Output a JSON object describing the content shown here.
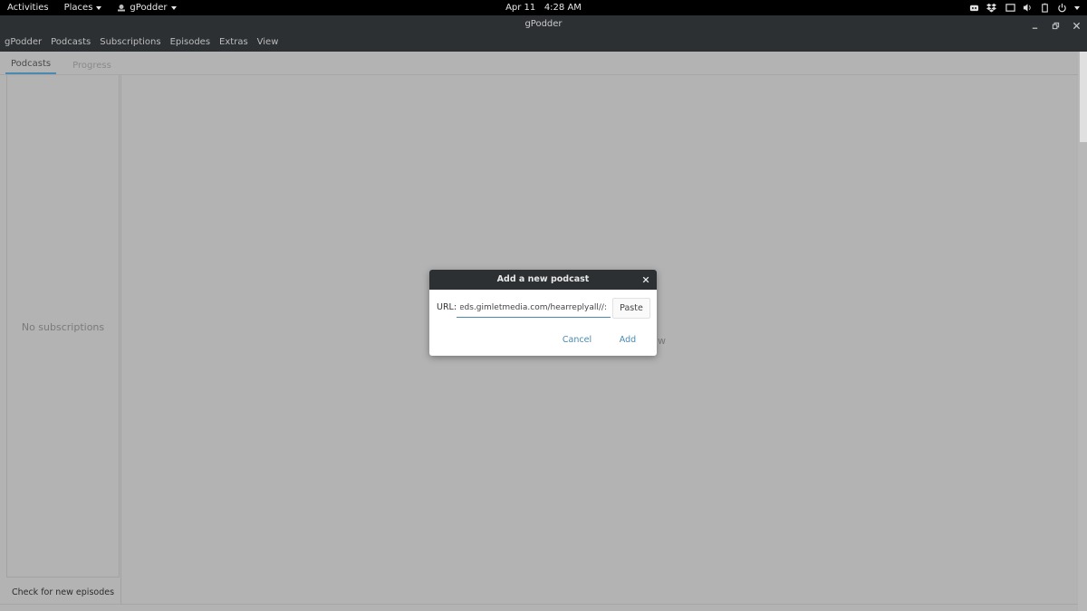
{
  "topbar": {
    "activities": "Activities",
    "places": "Places",
    "app_menu": "gPodder",
    "clock": "Apr 11   4:28 AM",
    "tray_icons": [
      "discord-icon",
      "dropbox-icon",
      "display-icon",
      "volume-icon",
      "battery-icon",
      "power-icon"
    ]
  },
  "window": {
    "title": "gPodder",
    "menu": [
      "gPodder",
      "Podcasts",
      "Subscriptions",
      "Episodes",
      "Extras",
      "View"
    ]
  },
  "tabs": [
    {
      "label": "Podcasts",
      "active": true
    },
    {
      "label": "Progress",
      "active": false
    }
  ],
  "sidebar": {
    "empty_text": "No subscriptions",
    "check_button": "Check for new episodes"
  },
  "main": {
    "peek_text": "w"
  },
  "dialog": {
    "title": "Add a new podcast",
    "url_label": "URL:",
    "url_value": "://feeds.gimletmedia.com/hearreplyall",
    "paste_label": "Paste",
    "cancel_label": "Cancel",
    "add_label": "Add"
  },
  "colors": {
    "accent": "#4a8ab0",
    "header_bg": "#2c3033",
    "dim_bg": "#b3b3b3"
  }
}
